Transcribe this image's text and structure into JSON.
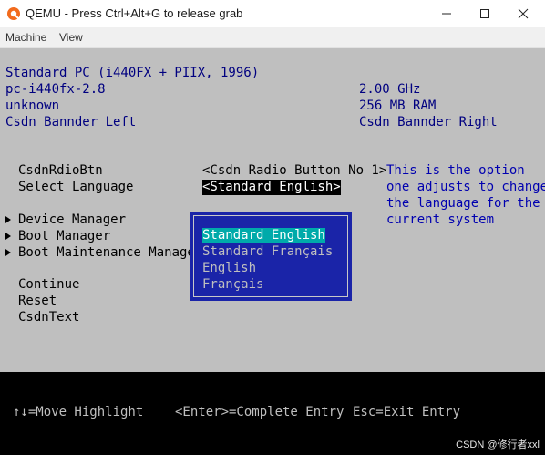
{
  "window": {
    "title": "QEMU - Press Ctrl+Alt+G to release grab",
    "app_icon": "qemu-icon",
    "controls": [
      "minimize-icon",
      "maximize-icon",
      "close-icon"
    ]
  },
  "menubar": {
    "items": [
      "Machine",
      "View"
    ]
  },
  "bios": {
    "info_left": [
      "Standard PC (i440FX + PIIX, 1996)",
      "pc-i440fx-2.8",
      "unknown",
      "Csdn Bannder Left"
    ],
    "info_right": [
      "2.00 GHz",
      "256 MB RAM",
      "Csdn Bannder Right"
    ],
    "radio_label": "CsdnRdioBtn",
    "radio_value": "<Csdn Radio Button No 1>",
    "language_label": "Select Language",
    "language_value": "<Standard English>",
    "submenus": [
      "Device Manager",
      "Boot Manager",
      "Boot Maintenance Manager"
    ],
    "actions": [
      "Continue",
      "Reset",
      "CsdnText"
    ],
    "help_lines": [
      "This is the option",
      "one adjusts to change",
      "the language for the",
      "current system"
    ],
    "popup_options": [
      "Standard English",
      "Standard Français",
      "English",
      "Français"
    ],
    "popup_selected_index": 0
  },
  "footer": {
    "move": "↑↓=Move Highlight",
    "enter": "<Enter>=Complete Entry",
    "esc": "Esc=Exit Entry",
    "watermark": "CSDN @修行者xxl"
  },
  "colors": {
    "screen_bg": "#bfbfbf",
    "text_blue": "#000080",
    "popup_bg": "#1a24a8",
    "popup_highlight": "#00aaaa",
    "footer_bg": "#000000"
  }
}
